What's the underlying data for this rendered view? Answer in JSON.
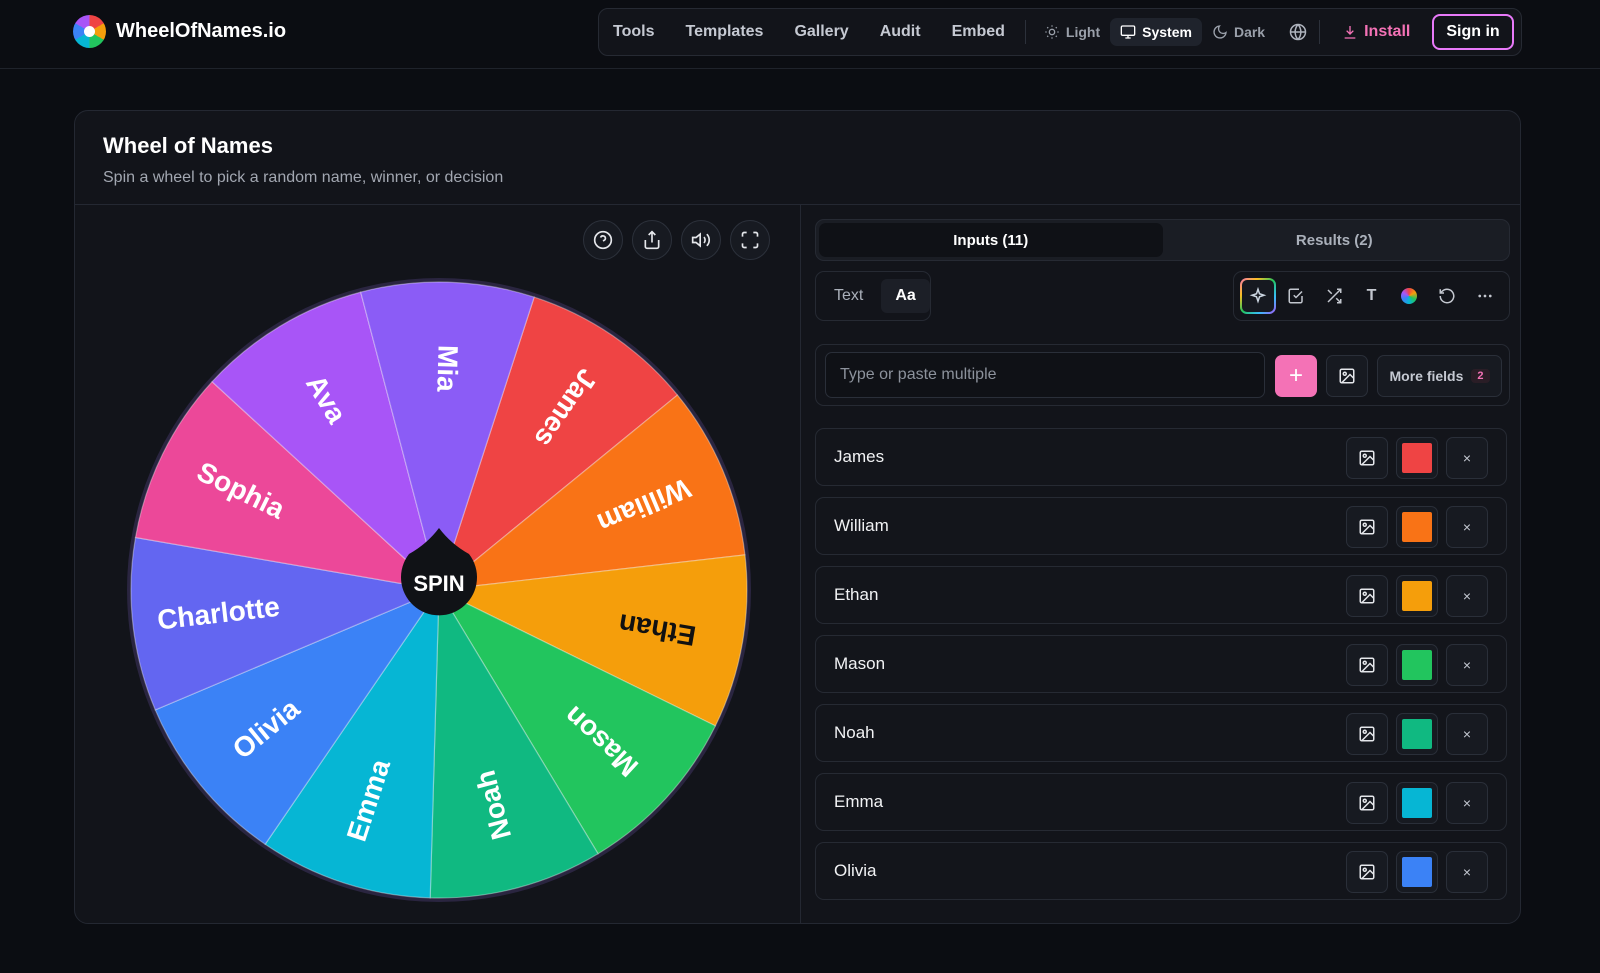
{
  "brand": {
    "name": "WheelOfNames.io",
    "logo_icon": "color-wheel-icon"
  },
  "nav": {
    "links": [
      "Tools",
      "Templates",
      "Gallery",
      "Audit",
      "Embed"
    ],
    "themes": {
      "light": "Light",
      "system": "System",
      "dark": "Dark",
      "selected": "System"
    },
    "install": "Install",
    "signin": "Sign in"
  },
  "card": {
    "title": "Wheel of Names",
    "subtitle": "Spin a wheel to pick a random name, winner, or decision"
  },
  "wheel": {
    "spin_label": "SPIN",
    "tool_icons": [
      "help-icon",
      "share-icon",
      "sound-icon",
      "fullscreen-icon"
    ],
    "segments": [
      {
        "name": "James",
        "color": "#ef4444"
      },
      {
        "name": "William",
        "color": "#f97316"
      },
      {
        "name": "Ethan",
        "color": "#f59e0b"
      },
      {
        "name": "Mason",
        "color": "#22c55e"
      },
      {
        "name": "Noah",
        "color": "#10b981"
      },
      {
        "name": "Emma",
        "color": "#06b6d4"
      },
      {
        "name": "Olivia",
        "color": "#3b82f6"
      },
      {
        "name": "Charlotte",
        "color": "#6366f1"
      },
      {
        "name": "Sophia",
        "color": "#ec4899"
      },
      {
        "name": "Ava",
        "color": "#a855f7"
      },
      {
        "name": "Mia",
        "color": "#8b5cf6"
      }
    ]
  },
  "panel": {
    "tabs": {
      "inputs": "Inputs (11)",
      "results": "Results (2)",
      "active": "inputs"
    },
    "mode": {
      "text": "Text",
      "aa": "Aa"
    },
    "toolbar_icons": [
      "sparkle-icon",
      "checkbox-icon",
      "shuffle-icon",
      "text-icon",
      "color-icon",
      "reset-icon",
      "more-icon"
    ],
    "toolbar_text_glyph": "T",
    "entry": {
      "placeholder": "Type or paste multiple",
      "value": "",
      "more_fields": "More fields",
      "more_count": "2",
      "add_glyph": "+"
    },
    "entries": [
      {
        "name": "James",
        "color": "#ef4444"
      },
      {
        "name": "William",
        "color": "#f97316"
      },
      {
        "name": "Ethan",
        "color": "#f59e0b"
      },
      {
        "name": "Mason",
        "color": "#22c55e"
      },
      {
        "name": "Noah",
        "color": "#10b981"
      },
      {
        "name": "Emma",
        "color": "#06b6d4"
      },
      {
        "name": "Olivia",
        "color": "#3b82f6"
      }
    ],
    "delete_glyph": "×"
  }
}
